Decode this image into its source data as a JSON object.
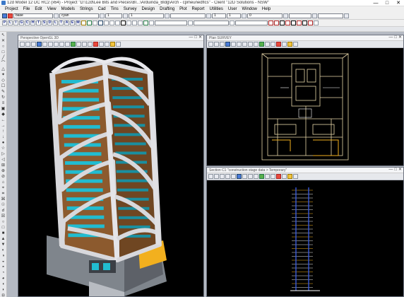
{
  "app": {
    "title": "12d Model 12 DC RC2 (x64) - Project \"D:\\12d\\Lee Bits and Pieces\\BI...\\Arduinda_Bldg\\Arch - cpmeunedflcs\" - Client \"12D Solutions - NSW\"",
    "controls": [
      "—",
      "□",
      "✕"
    ]
  },
  "menu": [
    "Project",
    "File",
    "Edit",
    "View",
    "Models",
    "Strings",
    "Cad",
    "Tins",
    "Survey",
    "Design",
    "Drafting",
    "Plot",
    "Report",
    "Utilities",
    "User",
    "Window",
    "Help"
  ],
  "toolbar": {
    "name_field": "base",
    "colour_field": "cyan",
    "field3": "1",
    "field4": "1",
    "field5": "1",
    "field6": "1",
    "field7": "0",
    "style_field": ""
  },
  "letter_buttons": [
    "P",
    "L",
    "I",
    "G",
    "C",
    "H",
    "T",
    "S",
    "D",
    "L",
    "T",
    "A",
    "E",
    "M"
  ],
  "left_tools": [
    "↖",
    "✕",
    "○",
    "□",
    "╱",
    "⌒",
    "△",
    "✦",
    "◇",
    "☐",
    "✎",
    "↻",
    "≡",
    "▣",
    "◆",
    "←",
    "→",
    "↑",
    "↓",
    "●",
    "☆",
    "▷",
    "◁",
    "⊞",
    "⊕",
    "⊘",
    "⌂",
    "⌖",
    "⌗",
    "⌘",
    "☉",
    "☌",
    "☒",
    "○",
    "□",
    "■",
    "▲",
    "▼",
    "◐",
    "◑",
    "◒",
    "◓",
    "◔",
    "◕",
    "◖",
    "◗",
    "◘",
    "◙"
  ],
  "windows": {
    "perspective": {
      "title": "Perspective OpenGL 3D"
    },
    "plan": {
      "title": "Plan SURVEY"
    },
    "section": {
      "title": "Section C1 \"construction stage data > Temporary\""
    }
  },
  "colors": {
    "facade": "#d8d8dc",
    "glass": "#21bcd0",
    "core": "#8c5a2e",
    "slab": "#9aa0a8",
    "podium_yellow": "#f2b01e",
    "plan_lines": "#e8d6a8",
    "section_blue": "#3a5ad8"
  }
}
